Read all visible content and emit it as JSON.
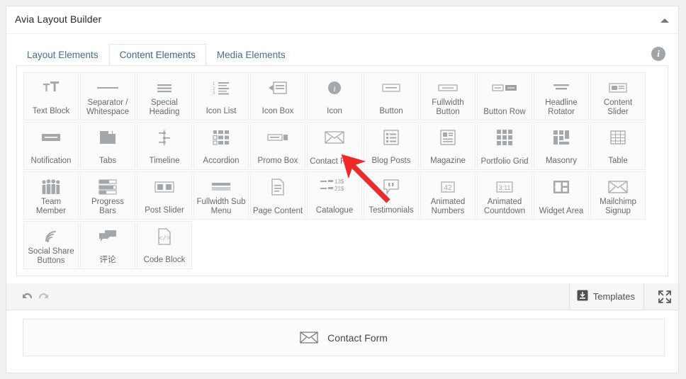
{
  "window": {
    "title": "Avia Layout Builder",
    "collapse_icon": "triangle-up-icon"
  },
  "tabs": [
    {
      "label": "Layout Elements",
      "active": false
    },
    {
      "label": "Content Elements",
      "active": true
    },
    {
      "label": "Media Elements",
      "active": false
    }
  ],
  "info_icon": {
    "glyph": "i",
    "name": "info-icon"
  },
  "elements": [
    [
      {
        "label": "Text Block",
        "icon": "text-block-icon"
      },
      {
        "label": "Separator / Whitespace",
        "icon": "separator-icon"
      },
      {
        "label": "Special Heading",
        "icon": "heading-icon"
      },
      {
        "label": "Icon List",
        "icon": "icon-list-icon"
      },
      {
        "label": "Icon Box",
        "icon": "icon-box-icon"
      },
      {
        "label": "Icon",
        "icon": "info-circle-icon"
      },
      {
        "label": "Button",
        "icon": "button-icon"
      },
      {
        "label": "Fullwidth Button",
        "icon": "fullwidth-button-icon"
      },
      {
        "label": "Button Row",
        "icon": "button-row-icon"
      },
      {
        "label": "Headline Rotator",
        "icon": "headline-rotator-icon"
      },
      {
        "label": "Content Slider",
        "icon": "content-slider-icon"
      }
    ],
    [
      {
        "label": "Notification",
        "icon": "notification-icon"
      },
      {
        "label": "Tabs",
        "icon": "tabs-icon"
      },
      {
        "label": "Timeline",
        "icon": "timeline-icon"
      },
      {
        "label": "Accordion",
        "icon": "accordion-icon"
      },
      {
        "label": "Promo Box",
        "icon": "promo-box-icon"
      },
      {
        "label": "Contact Form",
        "icon": "envelope-icon"
      },
      {
        "label": "Blog Posts",
        "icon": "blog-posts-icon"
      },
      {
        "label": "Magazine",
        "icon": "magazine-icon"
      },
      {
        "label": "Portfolio Grid",
        "icon": "portfolio-grid-icon"
      },
      {
        "label": "Masonry",
        "icon": "masonry-icon"
      },
      {
        "label": "Table",
        "icon": "table-icon"
      }
    ],
    [
      {
        "label": "Team Member",
        "icon": "team-member-icon"
      },
      {
        "label": "Progress Bars",
        "icon": "progress-bars-icon"
      },
      {
        "label": "Post Slider",
        "icon": "post-slider-icon"
      },
      {
        "label": "Fullwidth Sub Menu",
        "icon": "sub-menu-icon"
      },
      {
        "label": "Page Content",
        "icon": "page-content-icon"
      },
      {
        "label": "Catalogue",
        "icon": "catalogue-icon"
      },
      {
        "label": "Testimonials",
        "icon": "quote-bubble-icon"
      },
      {
        "label": "Animated Numbers",
        "icon": "animated-numbers-icon"
      },
      {
        "label": "Animated Countdown",
        "icon": "animated-countdown-icon"
      },
      {
        "label": "Widget Area",
        "icon": "widget-area-icon"
      },
      {
        "label": "Mailchimp Signup",
        "icon": "envelope-icon"
      }
    ],
    [
      {
        "label": "Social Share Buttons",
        "icon": "share-icon"
      },
      {
        "label": "评论",
        "icon": "comments-icon"
      },
      {
        "label": "Code Block",
        "icon": "code-block-icon"
      }
    ]
  ],
  "catalogue_icon_text": {
    "price_1": "13$",
    "price_2": "21$"
  },
  "animated_numbers_icon_text": "42",
  "animated_countdown_icon_text": "3:11",
  "toolbar": {
    "undo_label": "undo-icon",
    "redo_label": "redo-icon",
    "templates_label": "Templates",
    "templates_icon": "save-box-icon",
    "fullscreen_icon": "fullscreen-icon"
  },
  "canvas": {
    "elements": [
      {
        "label": "Contact Form",
        "icon": "envelope-icon"
      }
    ]
  },
  "annotation": {
    "type": "arrow",
    "color": "#ee2b2b",
    "points_to": "Contact Form"
  },
  "colors": {
    "page_bg": "#f1f1f1",
    "panel_bg": "#ffffff",
    "tile_bg": "#fbfbfb",
    "border": "#e4e4e4",
    "tab_link": "#43708c",
    "label_text": "#646a6e",
    "annotation_red": "#ee2b2b"
  }
}
